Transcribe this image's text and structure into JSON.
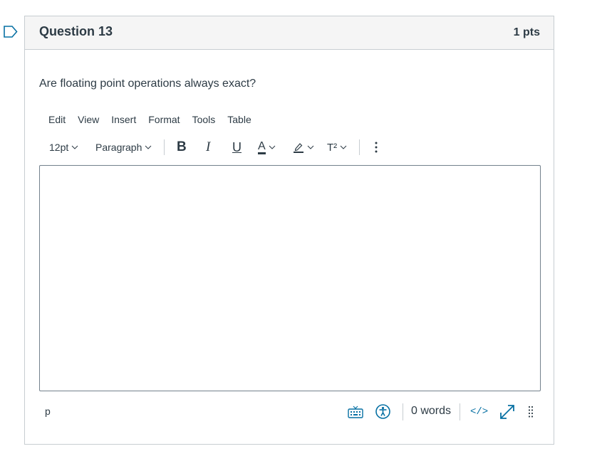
{
  "question": {
    "title": "Question 13",
    "points": "1 pts",
    "text": "Are floating point operations always exact?"
  },
  "menubar": {
    "items": [
      "Edit",
      "View",
      "Insert",
      "Format",
      "Tools",
      "Table"
    ]
  },
  "toolbar": {
    "font_size": "12pt",
    "block_format": "Paragraph",
    "bold": "B",
    "italic": "I",
    "underline": "U",
    "text_color": "A",
    "superscript": "T²"
  },
  "statusbar": {
    "path": "p",
    "word_count": "0 words",
    "html_editor": "</>"
  },
  "colors": {
    "accent": "#0770a3",
    "text": "#2d3b45",
    "border": "#c7cdd1",
    "header_bg": "#f5f5f5"
  },
  "icons": [
    "flag-icon",
    "chevron-down-icon",
    "highlight-pen-icon",
    "more-icon",
    "keyboard-icon",
    "accessibility-icon",
    "fullscreen-icon",
    "resize-handle-icon"
  ]
}
